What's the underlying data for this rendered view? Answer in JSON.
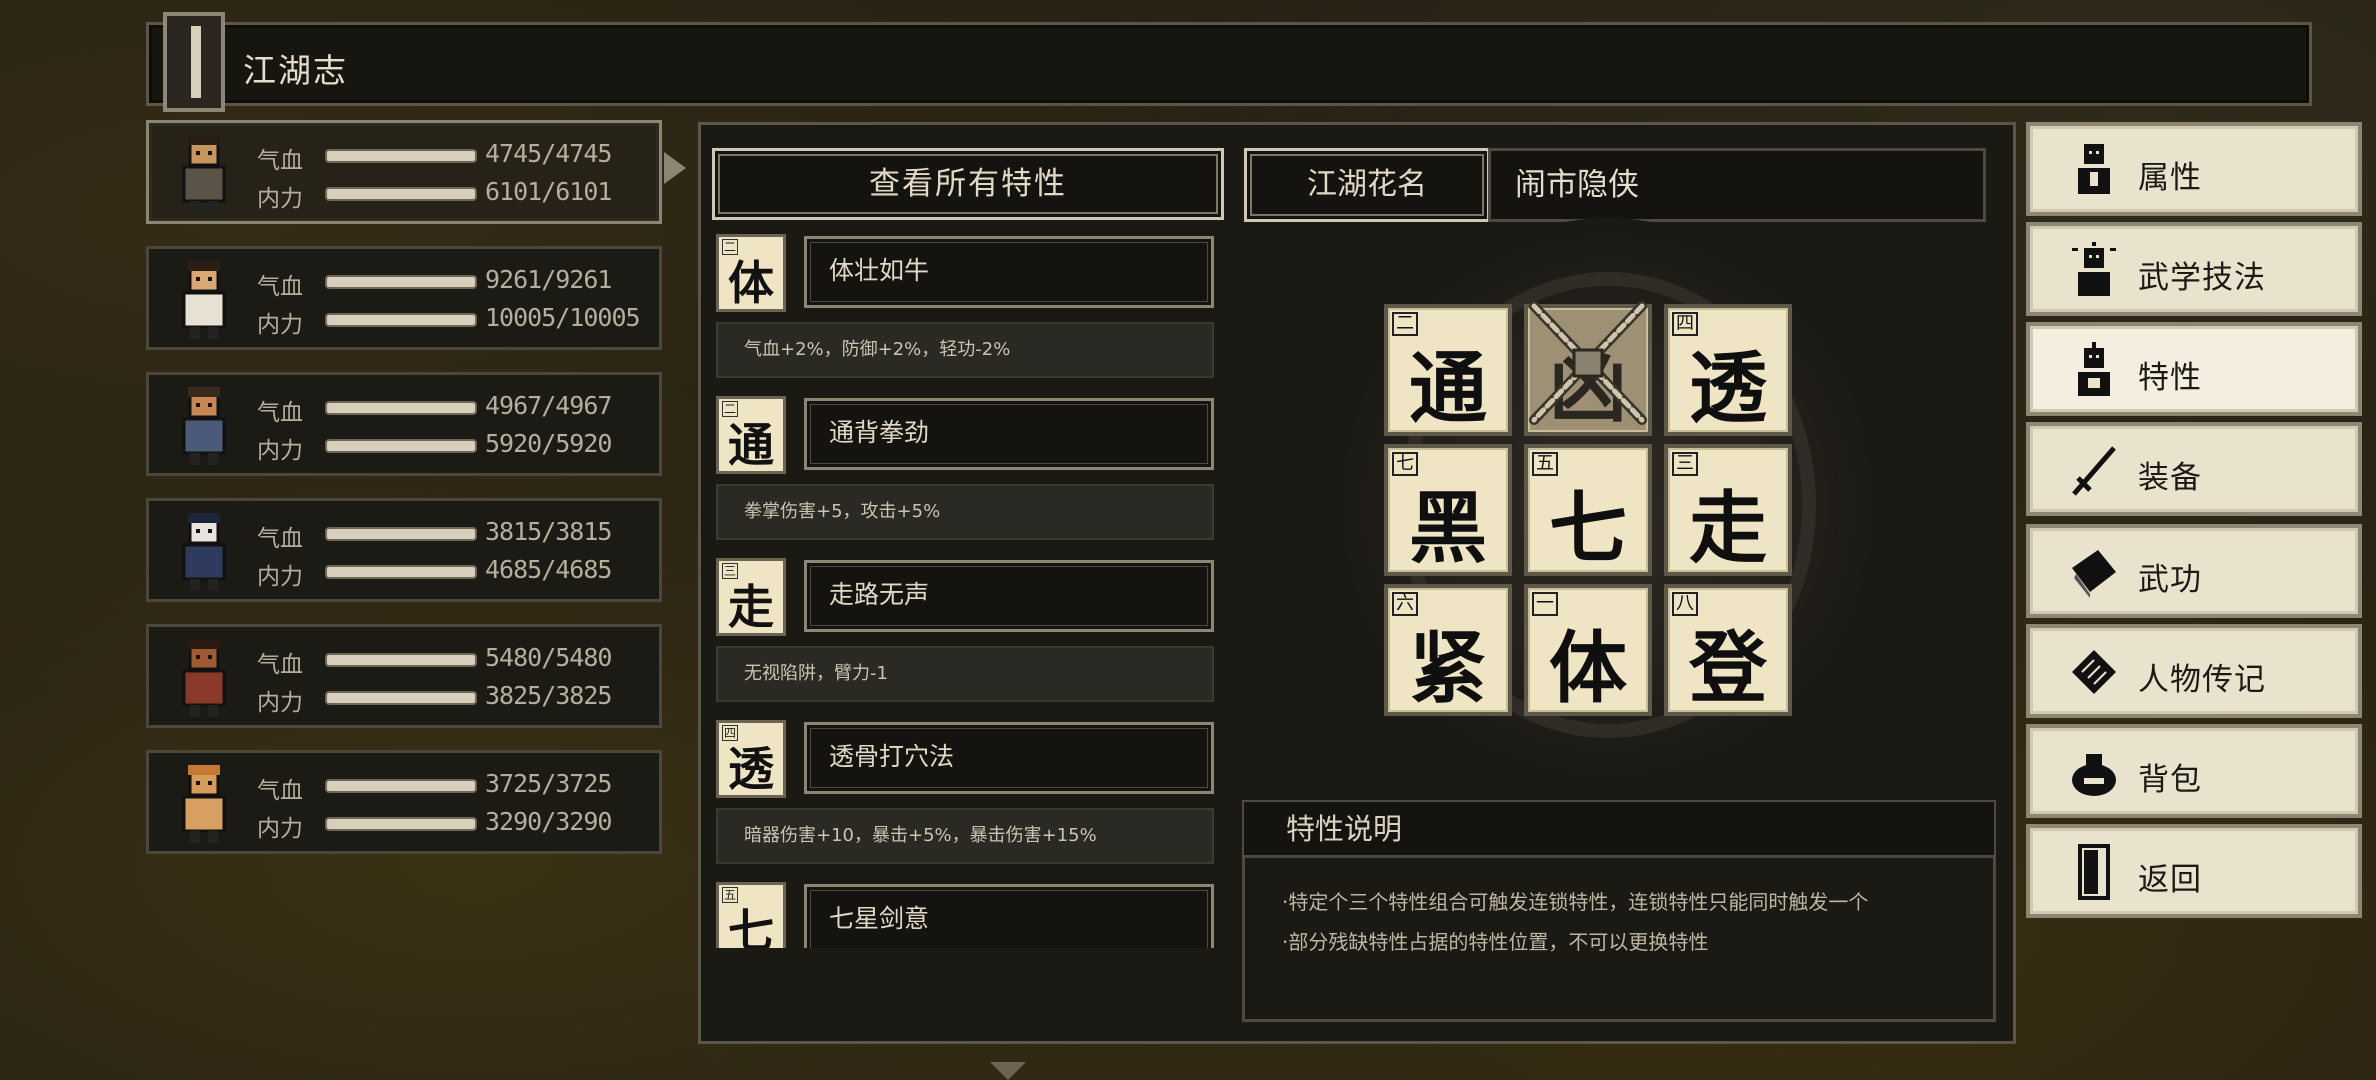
{
  "title": "江湖志",
  "party": [
    {
      "hp_label": "气血",
      "hp": "4745/4745",
      "mp_label": "内力",
      "mp": "6101/6101",
      "active": true
    },
    {
      "hp_label": "气血",
      "hp": "9261/9261",
      "mp_label": "内力",
      "mp": "10005/10005",
      "active": false
    },
    {
      "hp_label": "气血",
      "hp": "4967/4967",
      "mp_label": "内力",
      "mp": "5920/5920",
      "active": false
    },
    {
      "hp_label": "气血",
      "hp": "3815/3815",
      "mp_label": "内力",
      "mp": "4685/4685",
      "active": false
    },
    {
      "hp_label": "气血",
      "hp": "5480/5480",
      "mp_label": "内力",
      "mp": "3825/3825",
      "active": false
    },
    {
      "hp_label": "气血",
      "hp": "3725/3725",
      "mp_label": "内力",
      "mp": "3290/3290",
      "active": false
    }
  ],
  "view_all_label": "查看所有特性",
  "traits": [
    {
      "num": "二",
      "glyph": "体",
      "name": "体壮如牛",
      "desc": "气血+2%，防御+2%，轻功-2%"
    },
    {
      "num": "二",
      "glyph": "通",
      "name": "通背拳劲",
      "desc": "拳掌伤害+5，攻击+5%"
    },
    {
      "num": "三",
      "glyph": "走",
      "name": "走路无声",
      "desc": "无视陷阱，臂力-1"
    },
    {
      "num": "四",
      "glyph": "透",
      "name": "透骨打穴法",
      "desc": "暗器伤害+10，暴击+5%，暴击伤害+15%"
    },
    {
      "num": "五",
      "glyph": "七",
      "name": "七星剑意",
      "desc": ""
    }
  ],
  "nickname": {
    "label": "江湖花名",
    "value": "闹市隐侠"
  },
  "board": [
    {
      "num": "二",
      "glyph": "通",
      "locked": false
    },
    {
      "num": "",
      "glyph": "凶",
      "locked": true
    },
    {
      "num": "四",
      "glyph": "透",
      "locked": false
    },
    {
      "num": "七",
      "glyph": "黑",
      "locked": false
    },
    {
      "num": "五",
      "glyph": "七",
      "locked": false
    },
    {
      "num": "三",
      "glyph": "走",
      "locked": false
    },
    {
      "num": "六",
      "glyph": "紧",
      "locked": false
    },
    {
      "num": "一",
      "glyph": "体",
      "locked": false
    },
    {
      "num": "八",
      "glyph": "登",
      "locked": false
    }
  ],
  "description": {
    "title": "特性说明",
    "lines": [
      "·特定个三个特性组合可触发连锁特性，连锁特性只能同时触发一个",
      "·部分残缺特性占据的特性位置，不可以更换特性"
    ]
  },
  "menu": [
    {
      "label": "属性",
      "icon": "person-icon",
      "active": false
    },
    {
      "label": "武学技法",
      "icon": "martial-person-icon",
      "active": false
    },
    {
      "label": "特性",
      "icon": "trait-person-icon",
      "active": true
    },
    {
      "label": "装备",
      "icon": "sword-icon",
      "active": false
    },
    {
      "label": "武功",
      "icon": "book-icon",
      "active": false
    },
    {
      "label": "人物传记",
      "icon": "scroll-icon",
      "active": false
    },
    {
      "label": "背包",
      "icon": "bag-icon",
      "active": false
    },
    {
      "label": "返回",
      "icon": "door-icon",
      "active": false
    }
  ],
  "colors": {
    "accent": "#cfc8b3",
    "panel": "#1b1914",
    "tile": "#efe5c4",
    "hp_bar": "#d8d0bd"
  }
}
